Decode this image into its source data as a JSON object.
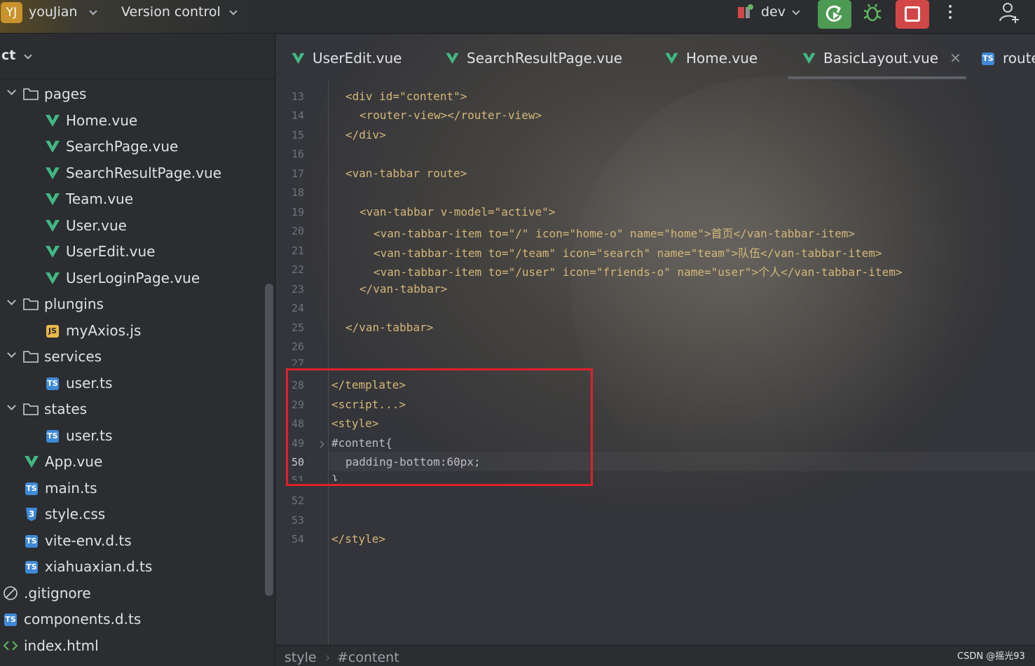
{
  "topbar": {
    "project_badge": "YJ",
    "project_name": "youJian",
    "vcs_label": "Version control",
    "branch": "dev"
  },
  "tree": {
    "header": "ct",
    "items": [
      {
        "label": "pages",
        "kind": "folder",
        "expanded": true
      },
      {
        "label": "Home.vue",
        "kind": "vue"
      },
      {
        "label": "SearchPage.vue",
        "kind": "vue"
      },
      {
        "label": "SearchResultPage.vue",
        "kind": "vue"
      },
      {
        "label": "Team.vue",
        "kind": "vue"
      },
      {
        "label": "User.vue",
        "kind": "vue"
      },
      {
        "label": "UserEdit.vue",
        "kind": "vue"
      },
      {
        "label": "UserLoginPage.vue",
        "kind": "vue"
      },
      {
        "label": "plungins",
        "kind": "folder",
        "expanded": true
      },
      {
        "label": "myAxios.js",
        "kind": "js"
      },
      {
        "label": "services",
        "kind": "folder",
        "expanded": true
      },
      {
        "label": "user.ts",
        "kind": "ts"
      },
      {
        "label": "states",
        "kind": "folder",
        "expanded": true
      },
      {
        "label": "user.ts",
        "kind": "ts"
      },
      {
        "label": "App.vue",
        "kind": "vue"
      },
      {
        "label": "main.ts",
        "kind": "ts"
      },
      {
        "label": "style.css",
        "kind": "css"
      },
      {
        "label": "vite-env.d.ts",
        "kind": "ts"
      },
      {
        "label": "xiahuaxian.d.ts",
        "kind": "ts"
      },
      {
        "label": ".gitignore",
        "kind": "ignore"
      },
      {
        "label": "components.d.ts",
        "kind": "ts"
      },
      {
        "label": "index.html",
        "kind": "html"
      }
    ]
  },
  "tabs": [
    {
      "label": "UserEdit.vue",
      "kind": "vue"
    },
    {
      "label": "SearchResultPage.vue",
      "kind": "vue"
    },
    {
      "label": "Home.vue",
      "kind": "vue"
    },
    {
      "label": "BasicLayout.vue",
      "kind": "vue",
      "active": true
    },
    {
      "label": "route",
      "kind": "ts"
    }
  ],
  "editor": {
    "line_numbers": [
      "13",
      "14",
      "15",
      "16",
      "17",
      "18",
      "19",
      "20",
      "21",
      "22",
      "23",
      "24",
      "25",
      "26",
      "27",
      "28",
      "29",
      "48",
      "49",
      "50",
      "51",
      "52",
      "53",
      "54"
    ],
    "current_line": "50",
    "code": {
      "l13": "<div id=\"content\">",
      "l14": "<router-view></router-view>",
      "l15": "</div>",
      "l17": "<van-tabbar route>",
      "l19": "<van-tabbar v-model=\"active\">",
      "l20": "<van-tabbar-item to=\"/\" icon=\"home-o\" name=\"home\">首页</van-tabbar-item>",
      "l21": "<van-tabbar-item to=\"/team\" icon=\"search\" name=\"team\">队伍</van-tabbar-item>",
      "l22": "<van-tabbar-item to=\"/user\" icon=\"friends-o\" name=\"user\">个人</van-tabbar-item>",
      "l23": "</van-tabbar>",
      "l25": "</van-tabbar>",
      "l28": "</template>",
      "l29": "<script...>",
      "l48": "<style>",
      "l49": "#content{",
      "l50": "padding-bottom:60px;",
      "l51": "}",
      "l54": "</style>"
    }
  },
  "breadcrumb": [
    "style",
    "#content"
  ],
  "watermark": "CSDN @摇光93",
  "colors": {
    "tag": "#d5b778",
    "string": "#6aab73",
    "number": "#2aacb8",
    "highlight_box": "#e0202b",
    "vue_green": "#41b883",
    "ts_blue": "#3f8ad8"
  }
}
